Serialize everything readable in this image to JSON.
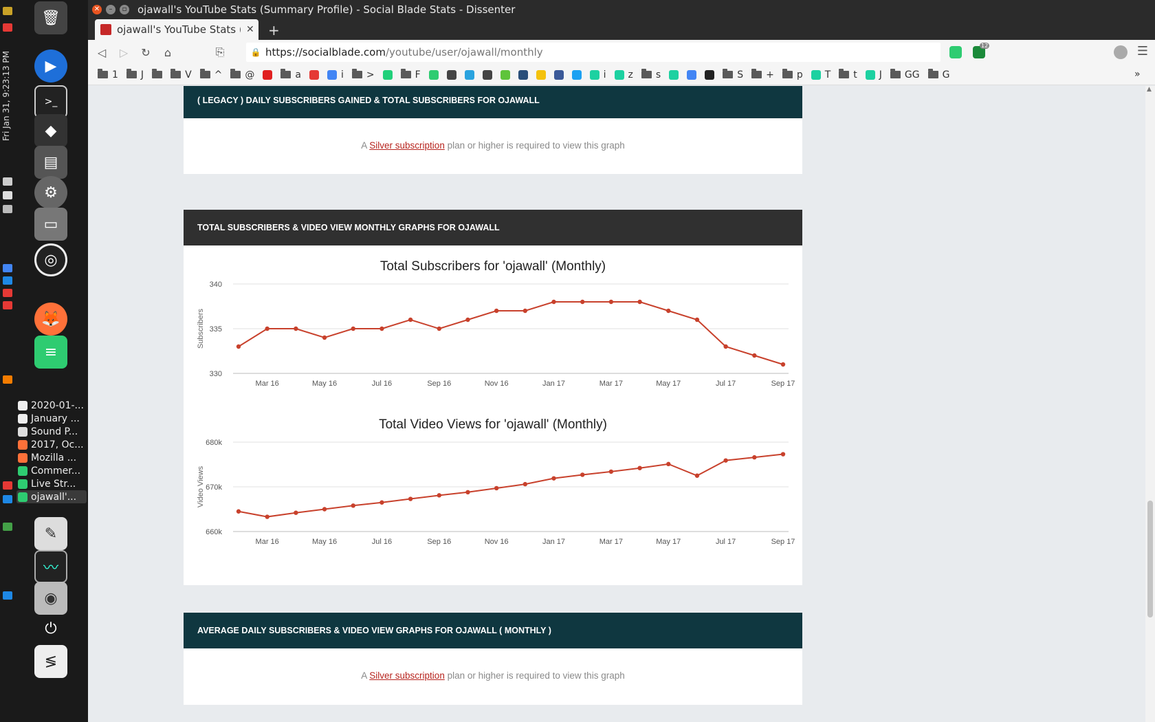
{
  "window": {
    "title": "ojawall's YouTube Stats (Summary Profile) - Social Blade Stats - Dissenter"
  },
  "dock": {
    "clock": "Fri Jan 31, 9:23:13 PM",
    "windows": [
      {
        "label": "2020-01-...",
        "color": "#eeeeee"
      },
      {
        "label": "January ...",
        "color": "#eeeeee"
      },
      {
        "label": "Sound P...",
        "color": "#dddddd"
      },
      {
        "label": "2017, Oc...",
        "color": "#ff7139"
      },
      {
        "label": "Mozilla ...",
        "color": "#ff7139"
      },
      {
        "label": "Commer...",
        "color": "#2ecc71"
      },
      {
        "label": "Live Str...",
        "color": "#2ecc71"
      },
      {
        "label": "ojawall'...",
        "color": "#2ecc71"
      }
    ]
  },
  "tab": {
    "label": "ojawall's YouTube Stats (Su",
    "close_glyph": "✕",
    "new_tab_glyph": "+"
  },
  "url": {
    "host": "https://socialblade.com",
    "path": "/youtube/user/ojawall/monthly"
  },
  "ext_badge": "12",
  "bookmarks": [
    {
      "label": "1",
      "kind": "folder"
    },
    {
      "label": "J",
      "kind": "folder"
    },
    {
      "label": "",
      "kind": "folder"
    },
    {
      "label": "V",
      "kind": "folder"
    },
    {
      "label": "^",
      "kind": "folder"
    },
    {
      "label": "@",
      "kind": "folder"
    },
    {
      "label": "",
      "kind": "icon",
      "color": "#e02020"
    },
    {
      "label": "a",
      "kind": "folder"
    },
    {
      "label": "",
      "kind": "icon",
      "color": "#e53935"
    },
    {
      "label": "i",
      "kind": "icon",
      "color": "#4285f4"
    },
    {
      "label": ">",
      "kind": "folder"
    },
    {
      "label": "",
      "kind": "icon",
      "color": "#21d07a"
    },
    {
      "label": "F",
      "kind": "folder"
    },
    {
      "label": "",
      "kind": "icon",
      "color": "#2ecc71"
    },
    {
      "label": "",
      "kind": "icon",
      "color": "#444444"
    },
    {
      "label": "",
      "kind": "icon",
      "color": "#2aa3df"
    },
    {
      "label": "",
      "kind": "icon",
      "color": "#444444"
    },
    {
      "label": "",
      "kind": "icon",
      "color": "#5ec43b"
    },
    {
      "label": "",
      "kind": "icon",
      "color": "#2a4f7a"
    },
    {
      "label": "",
      "kind": "icon",
      "color": "#f4c20d"
    },
    {
      "label": "",
      "kind": "icon",
      "color": "#3b5998"
    },
    {
      "label": "",
      "kind": "icon",
      "color": "#1da1f2"
    },
    {
      "label": "i",
      "kind": "icon",
      "color": "#1dd1a1"
    },
    {
      "label": "z",
      "kind": "icon",
      "color": "#1dd1a1"
    },
    {
      "label": "s",
      "kind": "folder"
    },
    {
      "label": "",
      "kind": "icon",
      "color": "#1dd1a1"
    },
    {
      "label": "",
      "kind": "icon",
      "color": "#4285f4"
    },
    {
      "label": "",
      "kind": "icon",
      "color": "#222222"
    },
    {
      "label": "S",
      "kind": "folder"
    },
    {
      "label": "+",
      "kind": "folder"
    },
    {
      "label": "p",
      "kind": "folder"
    },
    {
      "label": "T",
      "kind": "icon",
      "color": "#1dd1a1"
    },
    {
      "label": "t",
      "kind": "folder"
    },
    {
      "label": "J",
      "kind": "icon",
      "color": "#1dd1a1"
    },
    {
      "label": "GG",
      "kind": "folder"
    },
    {
      "label": "G",
      "kind": "folder"
    }
  ],
  "bookmarks_more": "»",
  "panels": {
    "legacy": {
      "heading": "( LEGACY ) DAILY SUBSCRIBERS GAINED & TOTAL SUBSCRIBERS FOR OJAWALL",
      "msg_pre": "A ",
      "msg_link": "Silver subscription",
      "msg_post": " plan or higher is required to view this graph"
    },
    "monthly": {
      "heading": "TOTAL SUBSCRIBERS & VIDEO VIEW MONTHLY GRAPHS FOR OJAWALL"
    },
    "average": {
      "heading": "AVERAGE DAILY SUBSCRIBERS & VIDEO VIEW GRAPHS FOR OJAWALL ( MONTHLY )",
      "msg_pre": "A ",
      "msg_link": "Silver subscription",
      "msg_post": " plan or higher is required to view this graph"
    }
  },
  "chart_data": [
    {
      "type": "line",
      "title": "Total Subscribers for 'ojawall' (Monthly)",
      "ylabel": "Subscribers",
      "xlabel": "",
      "color": "#c8412c",
      "ylim": [
        330,
        340
      ],
      "yticks": [
        "340",
        "335",
        "330"
      ],
      "ytick_values": [
        340,
        335,
        330
      ],
      "xticks": [
        "Mar 16",
        "May 16",
        "Jul 16",
        "Sep 16",
        "Nov 16",
        "Jan 17",
        "Mar 17",
        "May 17",
        "Jul 17",
        "Sep 17"
      ],
      "x": [
        "Feb 16",
        "Mar 16",
        "Apr 16",
        "May 16",
        "Jun 16",
        "Jul 16",
        "Aug 16",
        "Sep 16",
        "Oct 16",
        "Nov 16",
        "Dec 16",
        "Jan 17",
        "Feb 17",
        "Mar 17",
        "Apr 17",
        "May 17",
        "Jun 17",
        "Jul 17",
        "Aug 17",
        "Sep 17"
      ],
      "values": [
        333,
        335,
        335,
        334,
        335,
        335,
        336,
        335,
        336,
        337,
        337,
        338,
        338,
        338,
        338,
        337,
        336,
        333,
        332,
        331
      ]
    },
    {
      "type": "line",
      "title": "Total Video Views for 'ojawall' (Monthly)",
      "ylabel": "Video Views",
      "xlabel": "",
      "color": "#c8412c",
      "ylim": [
        660000,
        680000
      ],
      "yticks": [
        "680k",
        "670k",
        "660k"
      ],
      "ytick_values": [
        680000,
        670000,
        660000
      ],
      "xticks": [
        "Mar 16",
        "May 16",
        "Jul 16",
        "Sep 16",
        "Nov 16",
        "Jan 17",
        "Mar 17",
        "May 17",
        "Jul 17",
        "Sep 17"
      ],
      "x": [
        "Feb 16",
        "Mar 16",
        "Apr 16",
        "May 16",
        "Jun 16",
        "Jul 16",
        "Aug 16",
        "Sep 16",
        "Oct 16",
        "Nov 16",
        "Dec 16",
        "Jan 17",
        "Feb 17",
        "Mar 17",
        "Apr 17",
        "May 17",
        "Jun 17",
        "Jul 17",
        "Aug 17",
        "Sep 17"
      ],
      "values": [
        664500,
        663300,
        664200,
        665000,
        665800,
        666500,
        667300,
        668100,
        668800,
        669700,
        670600,
        671900,
        672700,
        673400,
        674200,
        675100,
        672500,
        675900,
        676600,
        677300
      ]
    }
  ]
}
